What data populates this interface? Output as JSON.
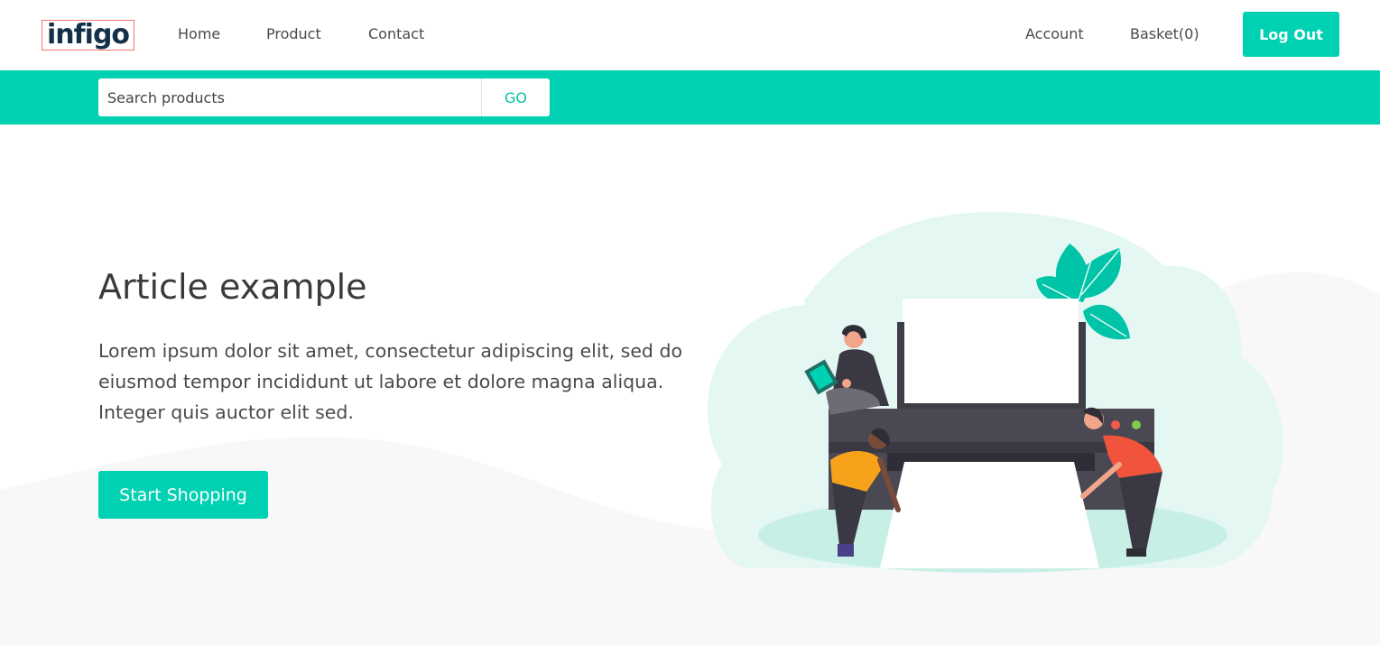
{
  "brand": {
    "logo_text": "infigo",
    "logo_color": "#143049"
  },
  "nav": {
    "home": "Home",
    "product": "Product",
    "contact": "Contact",
    "account": "Account",
    "basket": "Basket(0)",
    "logout": "Log Out"
  },
  "search": {
    "placeholder": "Search products",
    "value": "",
    "go_label": "GO"
  },
  "hero": {
    "title": "Article example",
    "text": "Lorem ipsum dolor sit amet, consectetur adipiscing elit, sed do eiusmod tempor incididunt ut labore et dolore magna aliqua. Integer quis auctor elit sed.",
    "cta_label": "Start Shopping"
  },
  "colors": {
    "accent": "#00d1b2",
    "text": "#3a3a3a",
    "hero_wave": "#f7f7f7",
    "illustration_bg": "#e4f7f3"
  },
  "illustration": {
    "icon": "printer-people-illustration"
  }
}
